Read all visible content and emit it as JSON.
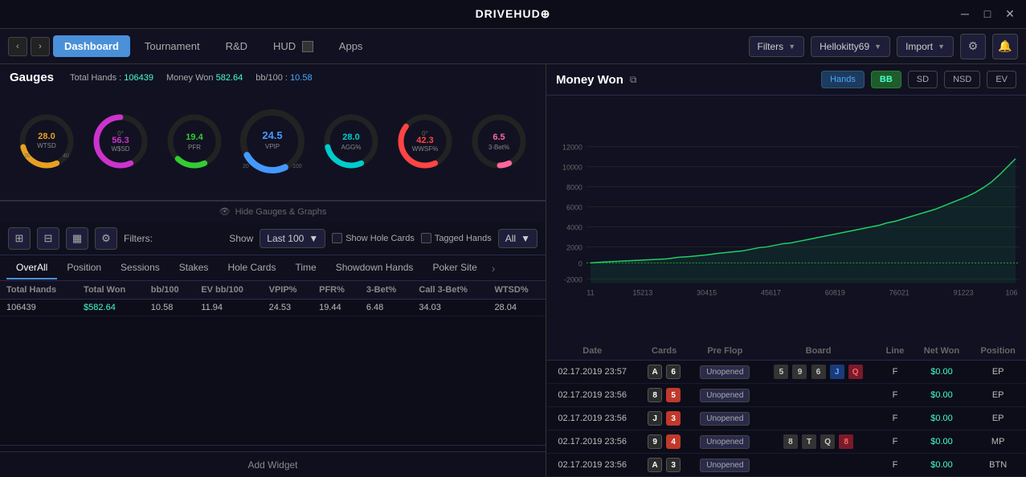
{
  "titlebar": {
    "logo": "DRIVEHUD⊕",
    "controls": [
      "─",
      "□",
      "✕"
    ]
  },
  "navbar": {
    "tabs": [
      {
        "id": "dashboard",
        "label": "Dashboard",
        "active": true
      },
      {
        "id": "tournament",
        "label": "Tournament",
        "active": false
      },
      {
        "id": "rd",
        "label": "R&D",
        "active": false
      },
      {
        "id": "hud",
        "label": "HUD",
        "active": false
      },
      {
        "id": "apps",
        "label": "Apps",
        "active": false
      }
    ],
    "filters_label": "Filters",
    "filters_arrow": "▼",
    "user": "Hellokitty69",
    "user_arrow": "▼",
    "import_label": "Import",
    "import_arrow": "▼"
  },
  "gauges": {
    "title": "Gauges",
    "total_hands_label": "Total Hands :",
    "total_hands_value": "106439",
    "money_won_label": "Money Won",
    "money_won_value": "582.64",
    "bb100_label": "bb/100 :",
    "bb100_value": "10.58",
    "items": [
      {
        "id": "wtsd",
        "label": "WTSD",
        "value": "28.0",
        "color": "#e8a020",
        "pct": 28
      },
      {
        "id": "wsd",
        "label": "W$SD",
        "value": "56.3",
        "sub_value": "0",
        "color": "#cc33cc",
        "pct": 56.3
      },
      {
        "id": "pfr",
        "label": "PFR",
        "value": "19.4",
        "color": "#33cc33",
        "pct": 19.4
      },
      {
        "id": "vpip",
        "label": "VPIP",
        "value": "24.5",
        "color": "#4499ff",
        "pct": 24.5
      },
      {
        "id": "agg",
        "label": "AGG%",
        "value": "28.0",
        "color": "#00cccc",
        "pct": 28
      },
      {
        "id": "wwsf",
        "label": "WWSF%",
        "value": "42.3",
        "sub_value": "0",
        "color": "#ff4444",
        "pct": 42.3
      },
      {
        "id": "3bet",
        "label": "3-Bet%",
        "value": "6.5",
        "color": "#ff6699",
        "pct": 6.5
      }
    ]
  },
  "hide_gauges_label": "Hide Gauges & Graphs",
  "tools": {
    "show_label": "Show",
    "show_value": "Last 100",
    "show_hole_cards": "Show Hole Cards",
    "tagged_hands": "Tagged Hands",
    "all_label": "All",
    "all_arrow": "▼",
    "filters_colon": "Filters:"
  },
  "data_tabs": [
    {
      "id": "overall",
      "label": "OverAll",
      "active": true
    },
    {
      "id": "position",
      "label": "Position"
    },
    {
      "id": "sessions",
      "label": "Sessions"
    },
    {
      "id": "stakes",
      "label": "Stakes"
    },
    {
      "id": "hole_cards",
      "label": "Hole Cards"
    },
    {
      "id": "time",
      "label": "Time"
    },
    {
      "id": "showdown",
      "label": "Showdown Hands"
    },
    {
      "id": "poker_site",
      "label": "Poker Site"
    }
  ],
  "summary_row": {
    "total_hands": "106439",
    "total_won": "$582.64",
    "bb100": "10.58",
    "ev_bb100": "11.94",
    "vpip_pct": "24.53",
    "pfr_pct": "19.44",
    "three_bet_pct": "6.48",
    "call_3bet_pct": "34.03",
    "wtsd_pct": "28.04"
  },
  "table_headers": {
    "left": [
      "Total Hands",
      "Total Won",
      "bb/100",
      "EV bb/100",
      "VPIP%",
      "PFR%",
      "3-Bet%",
      "Call 3-Bet%",
      "WTSD%"
    ]
  },
  "add_widget_label": "Add Widget",
  "money_won": {
    "title": "Money Won",
    "view_modes": [
      "Hands",
      "BB",
      "SD",
      "NSD",
      "EV"
    ],
    "active_mode": "BB",
    "active_secondary": "Hands",
    "y_axis": [
      "12000",
      "10000",
      "8000",
      "6000",
      "4000",
      "2000",
      "0",
      "-2000"
    ],
    "x_axis": [
      "11",
      "15213",
      "30415",
      "45617",
      "60819",
      "76021",
      "91223",
      "106"
    ]
  },
  "right_table": {
    "headers": [
      "Date",
      "Cards",
      "Pre Flop",
      "Board",
      "Line",
      "Net Won",
      "Position"
    ],
    "rows": [
      {
        "date": "02.17.2019 23:57",
        "cards": [
          {
            "val": "A",
            "suit": "spade",
            "color": "black"
          },
          {
            "val": "6",
            "suit": "spade",
            "color": "black"
          }
        ],
        "pre_flop": "Unopened",
        "board": [
          {
            "val": "5",
            "color": "gray"
          },
          {
            "val": "9",
            "color": "gray"
          },
          {
            "val": "6",
            "color": "gray"
          },
          {
            "val": "J",
            "color": "blue"
          },
          {
            "val": "Q",
            "color": "red"
          }
        ],
        "line": "F",
        "net_won": "$0.00",
        "position": "EP"
      },
      {
        "date": "02.17.2019 23:56",
        "cards": [
          {
            "val": "8",
            "suit": "club",
            "color": "black"
          },
          {
            "val": "5",
            "suit": "heart",
            "color": "red"
          }
        ],
        "pre_flop": "Unopened",
        "board": [],
        "line": "F",
        "net_won": "$0.00",
        "position": "EP"
      },
      {
        "date": "02.17.2019 23:56",
        "cards": [
          {
            "val": "J",
            "suit": "spade",
            "color": "black"
          },
          {
            "val": "3",
            "suit": "heart",
            "color": "red"
          }
        ],
        "pre_flop": "Unopened",
        "board": [],
        "line": "F",
        "net_won": "$0.00",
        "position": "EP"
      },
      {
        "date": "02.17.2019 23:56",
        "cards": [
          {
            "val": "9",
            "suit": "spade",
            "color": "black"
          },
          {
            "val": "4",
            "suit": "heart",
            "color": "red"
          }
        ],
        "pre_flop": "Unopened",
        "board": [
          {
            "val": "8",
            "color": "gray"
          },
          {
            "val": "T",
            "color": "gray"
          },
          {
            "val": "Q",
            "color": "gray"
          },
          {
            "val": "8",
            "color": "red"
          }
        ],
        "line": "F",
        "net_won": "$0.00",
        "position": "MP"
      },
      {
        "date": "02.17.2019 23:56",
        "cards": [
          {
            "val": "A",
            "suit": "club",
            "color": "black"
          },
          {
            "val": "3",
            "suit": "spade",
            "color": "black"
          }
        ],
        "pre_flop": "Unopened",
        "board": [],
        "line": "F",
        "net_won": "$0.00",
        "position": "BTN"
      }
    ]
  }
}
